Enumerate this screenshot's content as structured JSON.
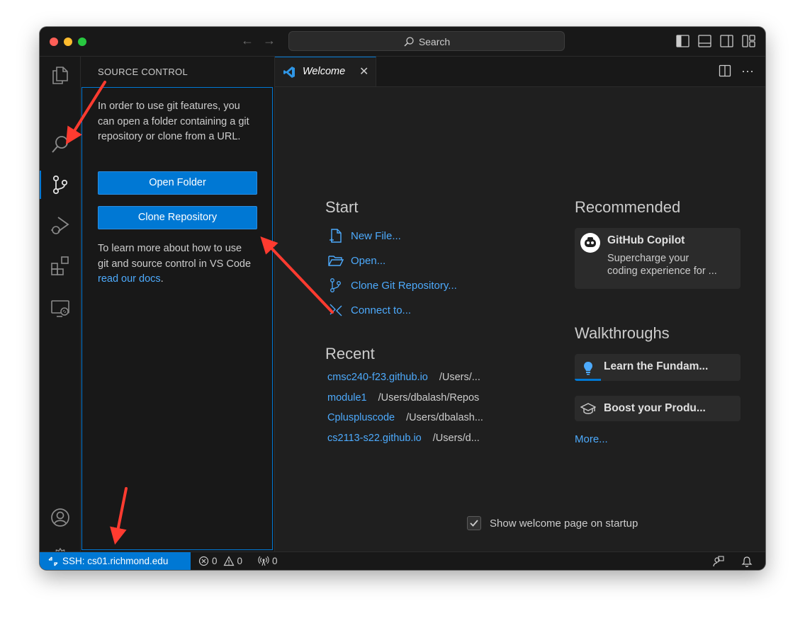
{
  "titlebar": {
    "search_placeholder": "Search",
    "back_icon": "arrow-left-icon",
    "forward_icon": "arrow-right-icon"
  },
  "activity_bar": {
    "items": [
      {
        "name": "explorer",
        "icon": "files-icon"
      },
      {
        "name": "search",
        "icon": "search-icon"
      },
      {
        "name": "source-control",
        "icon": "source-control-icon",
        "active": true
      },
      {
        "name": "run-debug",
        "icon": "run-debug-icon"
      },
      {
        "name": "extensions",
        "icon": "extensions-icon"
      },
      {
        "name": "remote-explorer",
        "icon": "remote-explorer-icon"
      }
    ],
    "bottom": [
      {
        "name": "accounts",
        "icon": "account-icon"
      },
      {
        "name": "manage",
        "icon": "gear-icon"
      }
    ]
  },
  "sidebar": {
    "title": "SOURCE CONTROL",
    "intro": "In order to use git features, you can open a folder containing a git repository or clone from a URL.",
    "open_folder_label": "Open Folder",
    "clone_repo_label": "Clone Repository",
    "learn_more_prefix": "To learn more about how to use git and source control in VS Code ",
    "learn_more_link": "read our docs",
    "learn_more_suffix": "."
  },
  "editor": {
    "tab_label": "Welcome",
    "start": {
      "heading": "Start",
      "items": [
        {
          "label": "New File...",
          "icon": "new-file-icon"
        },
        {
          "label": "Open...",
          "icon": "folder-open-icon"
        },
        {
          "label": "Clone Git Repository...",
          "icon": "source-control-icon"
        },
        {
          "label": "Connect to...",
          "icon": "remote-icon"
        }
      ]
    },
    "recent": {
      "heading": "Recent",
      "items": [
        {
          "name": "cmsc240-f23.github.io",
          "path": "/Users/..."
        },
        {
          "name": "module1",
          "path": "/Users/dbalash/Repos"
        },
        {
          "name": "Cpluspluscode",
          "path": "/Users/dbalash..."
        },
        {
          "name": "cs2113-s22.github.io",
          "path": "/Users/d..."
        }
      ]
    },
    "recommended": {
      "heading": "Recommended",
      "card_title": "GitHub Copilot",
      "card_desc_line1": "Supercharge your",
      "card_desc_line2": "coding experience for ..."
    },
    "walkthroughs": {
      "heading": "Walkthroughs",
      "items": [
        {
          "label": "Learn the Fundam...",
          "icon": "lightbulb-icon",
          "progress": 0.16
        },
        {
          "label": "Boost your Produ...",
          "icon": "mortarboard-icon"
        }
      ],
      "more_label": "More..."
    },
    "show_welcome_label": "Show welcome page on startup",
    "show_welcome_checked": true
  },
  "statusbar": {
    "remote_label": "SSH: cs01.richmond.edu",
    "errors": "0",
    "warnings": "0",
    "ports": "0"
  },
  "colors": {
    "accent": "#0078d4",
    "link": "#4daafc",
    "annotation_arrow": "#ff3b30"
  }
}
